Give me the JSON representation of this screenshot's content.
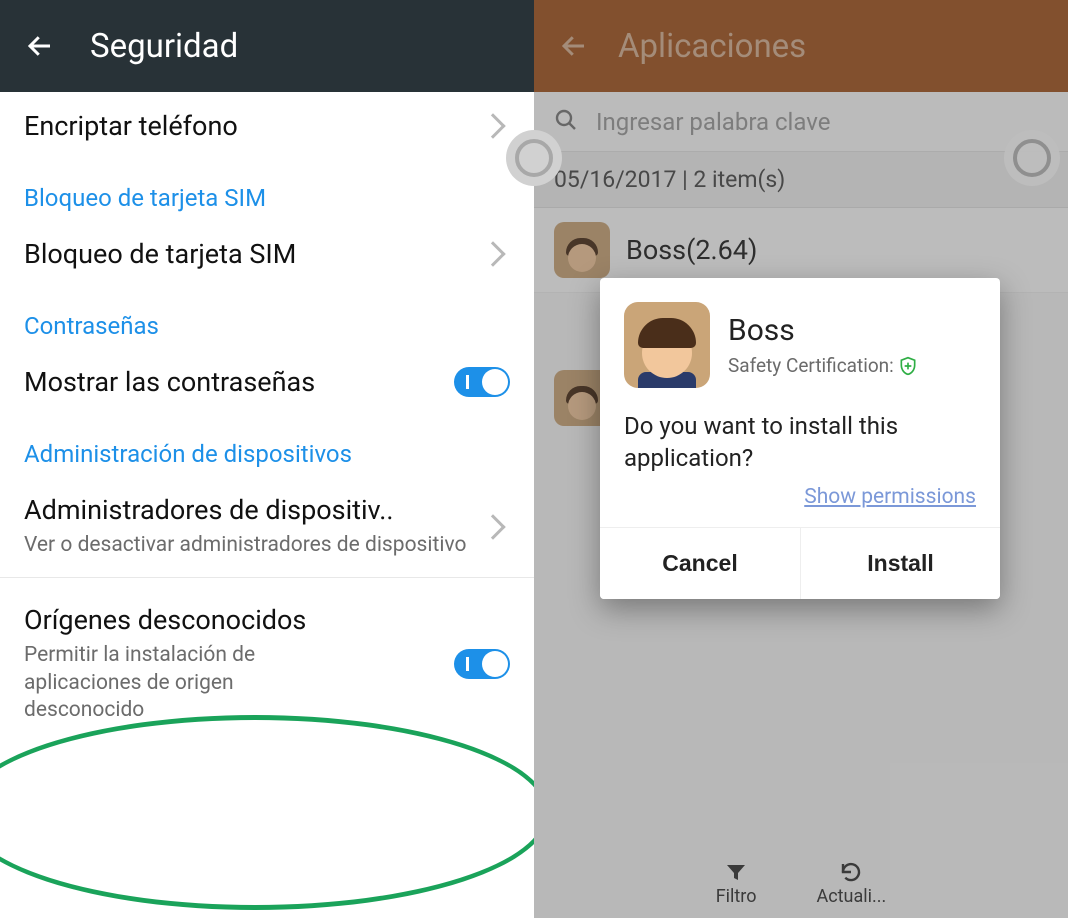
{
  "left": {
    "title": "Seguridad",
    "row_encrypt": "Encriptar teléfono",
    "sect_sim": "Bloqueo de tarjeta SIM",
    "row_simlock": "Bloqueo de tarjeta SIM",
    "sect_passwords": "Contraseñas",
    "row_showpw": "Mostrar las contraseñas",
    "sect_admin": "Administración de dispositivos",
    "row_admins_title": "Administradores de dispositiv..",
    "row_admins_sub": "Ver o desactivar administradores de dispositivo",
    "row_unknown_title": "Orígenes desconocidos",
    "row_unknown_sub": "Permitir la instalación de aplicaciones de origen desconocido"
  },
  "right": {
    "title": "Aplicaciones",
    "search_ph": "Ingresar palabra clave",
    "meta": "05/16/2017 | 2 item(s)",
    "item1": "Boss(2.64)",
    "bottom_filter": "Filtro",
    "bottom_update": "Actuali..."
  },
  "dialog": {
    "app": "Boss",
    "cert": "Safety Certification:",
    "msg": "Do you want to install this application?",
    "perm": "Show permissions",
    "cancel": "Cancel",
    "install": "Install"
  }
}
